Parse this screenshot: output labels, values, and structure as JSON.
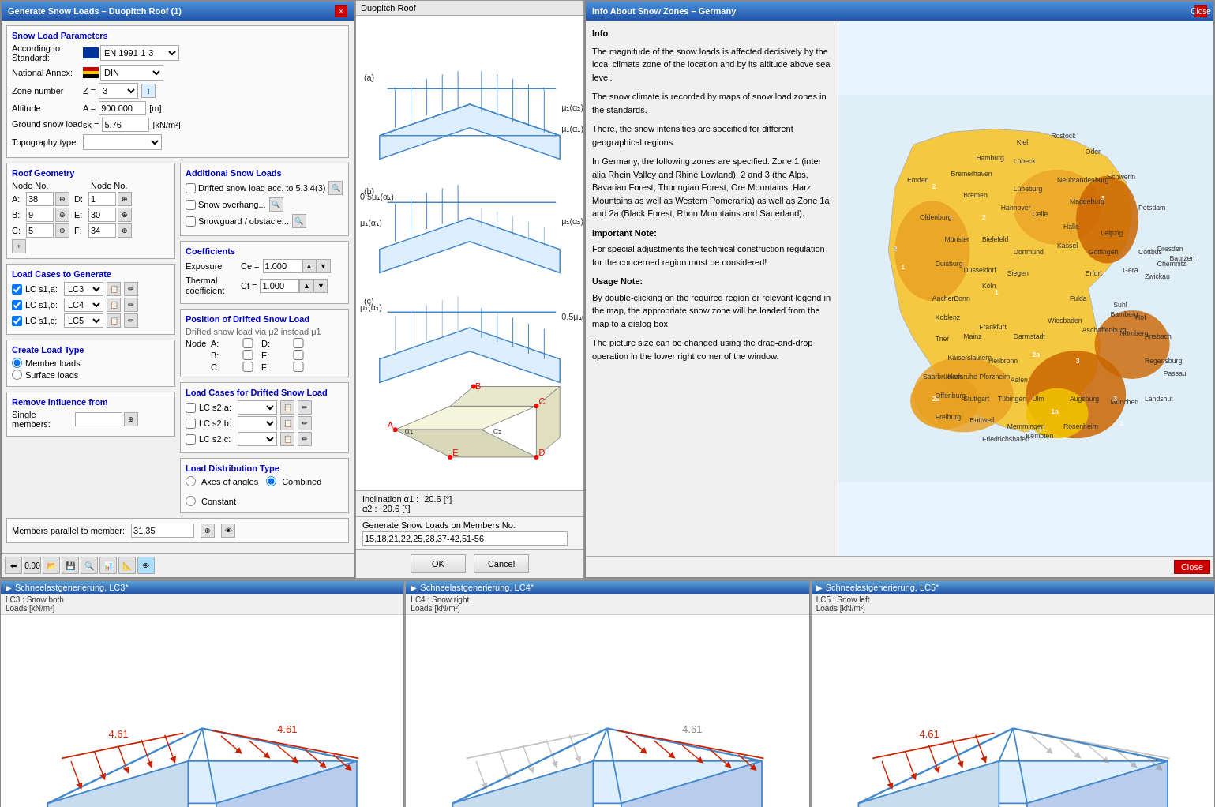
{
  "mainWindow": {
    "title": "Generate Snow Loads – Duopitch Roof  (1)",
    "closeLabel": "×"
  },
  "infoWindow": {
    "title": "Info About Snow Zones – Germany",
    "closeLabel": "Close"
  },
  "leftPanel": {
    "snowLoadParams": {
      "sectionTitle": "Snow Load Parameters",
      "accordingToLabel": "According to Standard:",
      "standardValue": "EN 1991-1-3",
      "nationalAnnexLabel": "National Annex:",
      "annexValue": "DIN",
      "zoneNumberLabel": "Zone number",
      "zonePrefix": "Z =",
      "zoneValue": "3",
      "altitudeLabel": "Altitude",
      "altitudePrefix": "A =",
      "altitudeValue": "900.000",
      "altitudeUnit": "[m]",
      "groundSnowLabel": "Ground snow load",
      "groundSnowPrefix": "sk =",
      "groundSnowValue": "5.76",
      "groundSnowUnit": "[kN/m²]",
      "topographyLabel": "Topography type:"
    },
    "additionalSnowLoads": {
      "sectionTitle": "Additional Snow Loads",
      "driftedLabel": "Drifted snow load acc. to 5.3.4(3)",
      "overhangLabel": "Snow overhang...",
      "snowguardLabel": "Snowguard / obstacle..."
    },
    "coefficients": {
      "sectionTitle": "Coefficients",
      "exposureLabel": "Exposure",
      "exposureSymbol": "Ce =",
      "exposureValue": "1.000",
      "thermalLabel": "Thermal coefficient",
      "thermalSymbol": "Ct =",
      "thermalValue": "1.000"
    },
    "positionDriftedSnow": {
      "sectionTitle": "Position of Drifted Snow Load",
      "driftedViaLabel": "Drifted snow load via μ2 instead μ1",
      "nodeALabel": "Node  A:",
      "nodeBLabel": "B:",
      "nodeCLabel": "C:",
      "nodeDLabel": "D:",
      "nodeELabel": "E:",
      "nodeFLabel": "F:"
    },
    "roofGeometry": {
      "sectionTitle": "Roof Geometry",
      "nodeNoLabel": "Node No.",
      "nodeNoLabel2": "Node No.",
      "aLabel": "A:",
      "aValue": "38",
      "bLabel": "B:",
      "bValue": "9",
      "cLabel": "C:",
      "cValue": "5",
      "dLabel": "D:",
      "dValue": "1",
      "eLabel": "E:",
      "eValue": "30",
      "fLabel": "F:",
      "fValue": "34"
    },
    "loadCases": {
      "sectionTitle": "Load Cases to Generate",
      "lc1Label": "LC s1,a:",
      "lc1Value": "LC3",
      "lc2Label": "LC s1,b:",
      "lc2Value": "LC4",
      "lc3Label": "LC s1,c:",
      "lc3Value": "LC5"
    },
    "driftedLoadCases": {
      "sectionTitle": "Load Cases for Drifted Snow Load",
      "lc1Label": "LC s2,a:",
      "lc2Label": "LC s2,b:",
      "lc3Label": "LC s2,c:"
    },
    "createLoadType": {
      "sectionTitle": "Create Load Type",
      "memberLoadsLabel": "Member loads",
      "surfaceLoadsLabel": "Surface loads"
    },
    "loadDistributionType": {
      "sectionTitle": "Load Distribution Type",
      "axesLabel": "Axes of angles",
      "constantLabel": "Constant",
      "combinedLabel": "Combined"
    },
    "removeInfluence": {
      "sectionTitle": "Remove Influence from",
      "singleMembersLabel": "Single members:"
    },
    "membersParallel": {
      "label": "Members parallel to member:",
      "value": "31,35"
    }
  },
  "middlePanel": {
    "title": "Duopitch Roof",
    "inclination1Label": "Inclination  α1 :",
    "inclination1Value": "20.6",
    "inclination1Unit": "[°]",
    "inclination2Label": "α2 :",
    "inclination2Value": "20.6",
    "inclination2Unit": "[°]",
    "generateLabel": "Generate Snow Loads on Members No.",
    "generateValue": "15,18,21,22,25,28,37-42,51-56",
    "okLabel": "OK",
    "cancelLabel": "Cancel"
  },
  "infoPanel": {
    "infoTitle": "Info",
    "infoText": "The magnitude of the snow loads is affected decisively by the local climate zone of the location and by its altitude above sea level.\n\nThe snow climate is recorded by maps of snow load zones in the standards.\n\nThere, the snow intensities are specified for different geographical regions.\n\nIn Germany, the following zones are specified: Zone 1 (inter alia Rhein Valley and Rhine Lowland), 2 and 3 (the Alps, Bavarian Forest, Thuringian Forest, Ore Mountains, Harz Mountains as well as Western Pomerania) as well as Zone 1a and 2a (Black Forest, Rhon Mountains and Sauerland).\n\nImportant Note:\nFor special adjustments the technical construction regulation for the concerned region must be considered!\n\nUsage Note:\nBy double-clicking on the required region or relevant legend in the map, the appropriate snow zone will be loaded from the map to a dialog box.\n\nThe picture size can be changed using the drag-and-drop operation in the lower right corner of the window.",
    "closeLabel": "Close"
  },
  "bottomPanels": [
    {
      "id": "lc3",
      "title": "Schneelastgenerierung, LC3*",
      "subtitle1": "LC3 : Snow both",
      "subtitle2": "Loads [kN/m^2]",
      "color": "#cc0000"
    },
    {
      "id": "lc4",
      "title": "Schneelastgenerierung, LC4*",
      "subtitle1": "LC4 : Snow right",
      "subtitle2": "Loads [kN/m^2]",
      "color": "#888888"
    },
    {
      "id": "lc5",
      "title": "Schneelastgenerierung, LC5*",
      "subtitle1": "LC5 : Snow left",
      "subtitle2": "Loads [kN/m^2]",
      "color": "#888888"
    }
  ],
  "icons": {
    "close": "×",
    "search": "🔍",
    "info": "i",
    "pick": "⊕",
    "arrow": "→"
  }
}
